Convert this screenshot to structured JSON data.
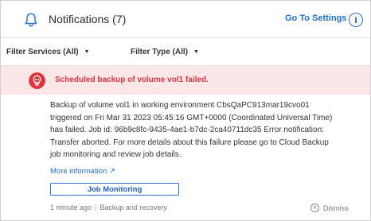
{
  "header": {
    "title": "Notifications (7)",
    "settings_link": "Go To Settings",
    "info_icon": "i"
  },
  "filters": {
    "services": "Filter Services (All)",
    "type": "Filter Type (All)",
    "caret": "▼"
  },
  "notification": {
    "severity": "error",
    "headline": "Scheduled backup of volume vol1 failed.",
    "body_lines": [
      "Backup of volume vol1 in working environment CbsQaPC913mar19cvo01",
      "triggered on Fri Mar 31 2023 05:45:16 GMT+0000 (Coordinated Universal Time)",
      "has failed. Job id: 96b9c8fc-9435-4ae1-b7dc-2ca40711dc35 Error notification:",
      "Transfer aborted. For more details about this failure please go to Cloud Backup",
      "job monitoring and review job details."
    ],
    "more_info": "More information ↗",
    "action_button": "Job Monitoring",
    "time": "1 minute ago",
    "source": "Backup and recovery",
    "dismiss": "Dismiss",
    "dismiss_icon": "×"
  },
  "colors": {
    "accent": "#1f6fd1",
    "error": "#d9363e",
    "error_bg": "#fbe7e7"
  }
}
